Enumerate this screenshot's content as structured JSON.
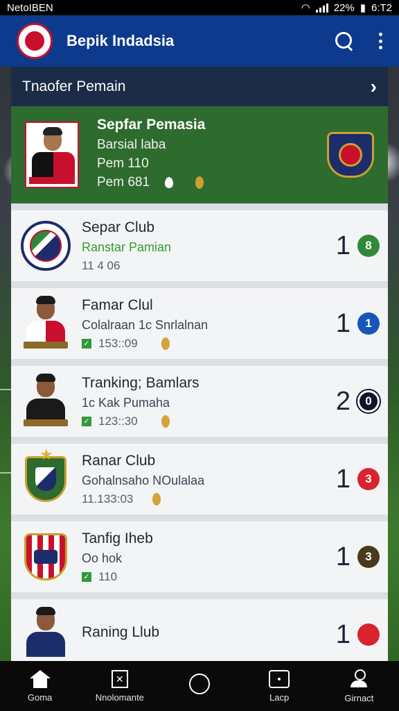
{
  "status_bar": {
    "carrier": "NetoIBEN",
    "battery": "22%",
    "time": "6:T2"
  },
  "app_bar": {
    "title": "Bepik Indadsia",
    "icons": [
      "search-icon",
      "more-vert-icon"
    ]
  },
  "section": {
    "title": "Tnaofer Pemain"
  },
  "featured": {
    "name": "Sepfar Pemasia",
    "line1": "Barsial laba",
    "line2": "Pem 110",
    "line3": "Pem 681"
  },
  "rows": [
    {
      "name": "Separ Club",
      "sub": "Ranstar Pamian",
      "meta": "11 4 06",
      "rank": "1",
      "badge": "8",
      "badge_color": "#2e8a3a",
      "checked": false
    },
    {
      "name": "Famar Clul",
      "sub": "Colalraan 1c Snrlalnan",
      "meta": "153::09",
      "rank": "1",
      "badge": "1",
      "badge_color": "#1556b8",
      "checked": true
    },
    {
      "name": "Tranking; Bamlars",
      "sub": "1c Kak Pumaha",
      "meta": "123::30",
      "rank": "2",
      "badge": "0",
      "badge_color": "#0f1726",
      "checked": true
    },
    {
      "name": "Ranar Club",
      "sub": "Gohalnsaho NOulalaa",
      "meta": "11.133:03",
      "rank": "1",
      "badge": "3",
      "badge_color": "#d9232e",
      "checked": false
    },
    {
      "name": "Tanfig Iheb",
      "sub": "Oo hok",
      "meta": "110",
      "rank": "1",
      "badge": "3",
      "badge_color": "#4a3a1c",
      "checked": true
    },
    {
      "name": "Raning Llub",
      "sub": "",
      "meta": "",
      "rank": "1",
      "badge": "",
      "badge_color": "#d9232e",
      "checked": false
    }
  ],
  "bottom_nav": [
    {
      "label": "Goma",
      "icon": "home-icon"
    },
    {
      "label": "Nnolomante",
      "icon": "tactics-icon"
    },
    {
      "label": "",
      "icon": "circle-icon"
    },
    {
      "label": "Lacp",
      "icon": "app-icon"
    },
    {
      "label": "Girnact",
      "icon": "user-icon"
    }
  ]
}
